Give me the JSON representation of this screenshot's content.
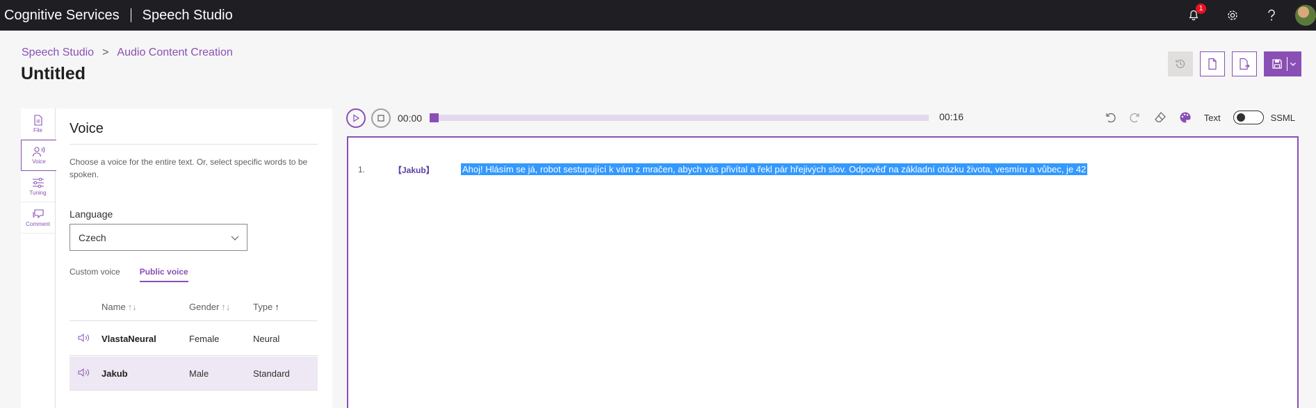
{
  "topbar": {
    "brand": "Cognitive Services",
    "product": "Speech Studio",
    "notification_count": "1"
  },
  "header": {
    "breadcrumb": [
      "Speech Studio",
      "Audio Content Creation"
    ],
    "breadcrumb_separator": ">",
    "title": "Untitled"
  },
  "leftnav": {
    "items": [
      {
        "label": "File",
        "icon": "file-icon"
      },
      {
        "label": "Voice",
        "icon": "voice-icon"
      },
      {
        "label": "Tuning",
        "icon": "tuning-icon"
      },
      {
        "label": "Comment",
        "icon": "comment-icon"
      }
    ]
  },
  "voice_panel": {
    "title": "Voice",
    "description": "Choose a voice for the entire text. Or, select specific words to be spoken.",
    "language_label": "Language",
    "language_value": "Czech",
    "tabs": [
      "Custom voice",
      "Public voice"
    ],
    "columns": [
      "Name",
      "Gender",
      "Type"
    ],
    "rows": [
      {
        "name": "VlastaNeural",
        "gender": "Female",
        "type": "Neural"
      },
      {
        "name": "Jakub",
        "gender": "Male",
        "type": "Standard"
      }
    ]
  },
  "player": {
    "current_time": "00:00",
    "total_time": "00:16",
    "progress": 0
  },
  "tools": {
    "text_label": "Text",
    "ssml_label": "SSML"
  },
  "editor": {
    "line_number": "1.",
    "voice_tag": "【Jakub】",
    "text": "Ahoj! Hlásím se já, robot sestupující k vám z mračen, abych vás přivítal a řekl pár hřejivých slov. Odpověď na základní otázku života, vesmíru a vůbec, je 42"
  },
  "colors": {
    "accent": "#8a4fb5",
    "topbar": "#1f1f23",
    "selection": "#3399ff"
  }
}
